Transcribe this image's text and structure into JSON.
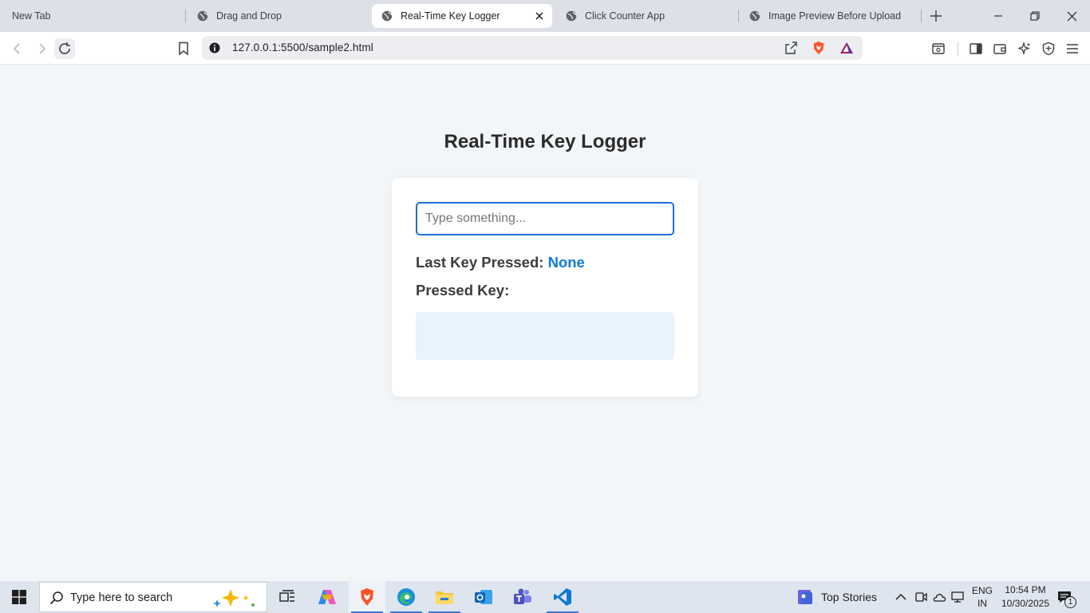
{
  "browser": {
    "tabs": [
      {
        "title": "New Tab"
      },
      {
        "title": "Drag and Drop"
      },
      {
        "title": "Real-Time Key Logger"
      },
      {
        "title": "Click Counter App"
      },
      {
        "title": "Image Preview Before Upload"
      }
    ],
    "url": "127.0.0.1:5500/sample2.html"
  },
  "page": {
    "title": "Real-Time Key Logger",
    "input_placeholder": "Type something...",
    "input_value": "",
    "last_key_label": "Last Key Pressed:",
    "last_key_value": "None",
    "pressed_key_label": "Pressed Key:",
    "pressed_key_value": ""
  },
  "taskbar": {
    "search_placeholder": "Type here to search",
    "news_label": "Top Stories",
    "language_line1": "ENG",
    "language_line2": "IN",
    "time": "10:54 PM",
    "date": "10/30/2025",
    "notification_count": "1"
  },
  "colors": {
    "accent": "#1a73d9",
    "value_blue": "#0a7ae0",
    "key_display_bg": "#e8f3fe",
    "page_bg": "#f3f6f9"
  }
}
